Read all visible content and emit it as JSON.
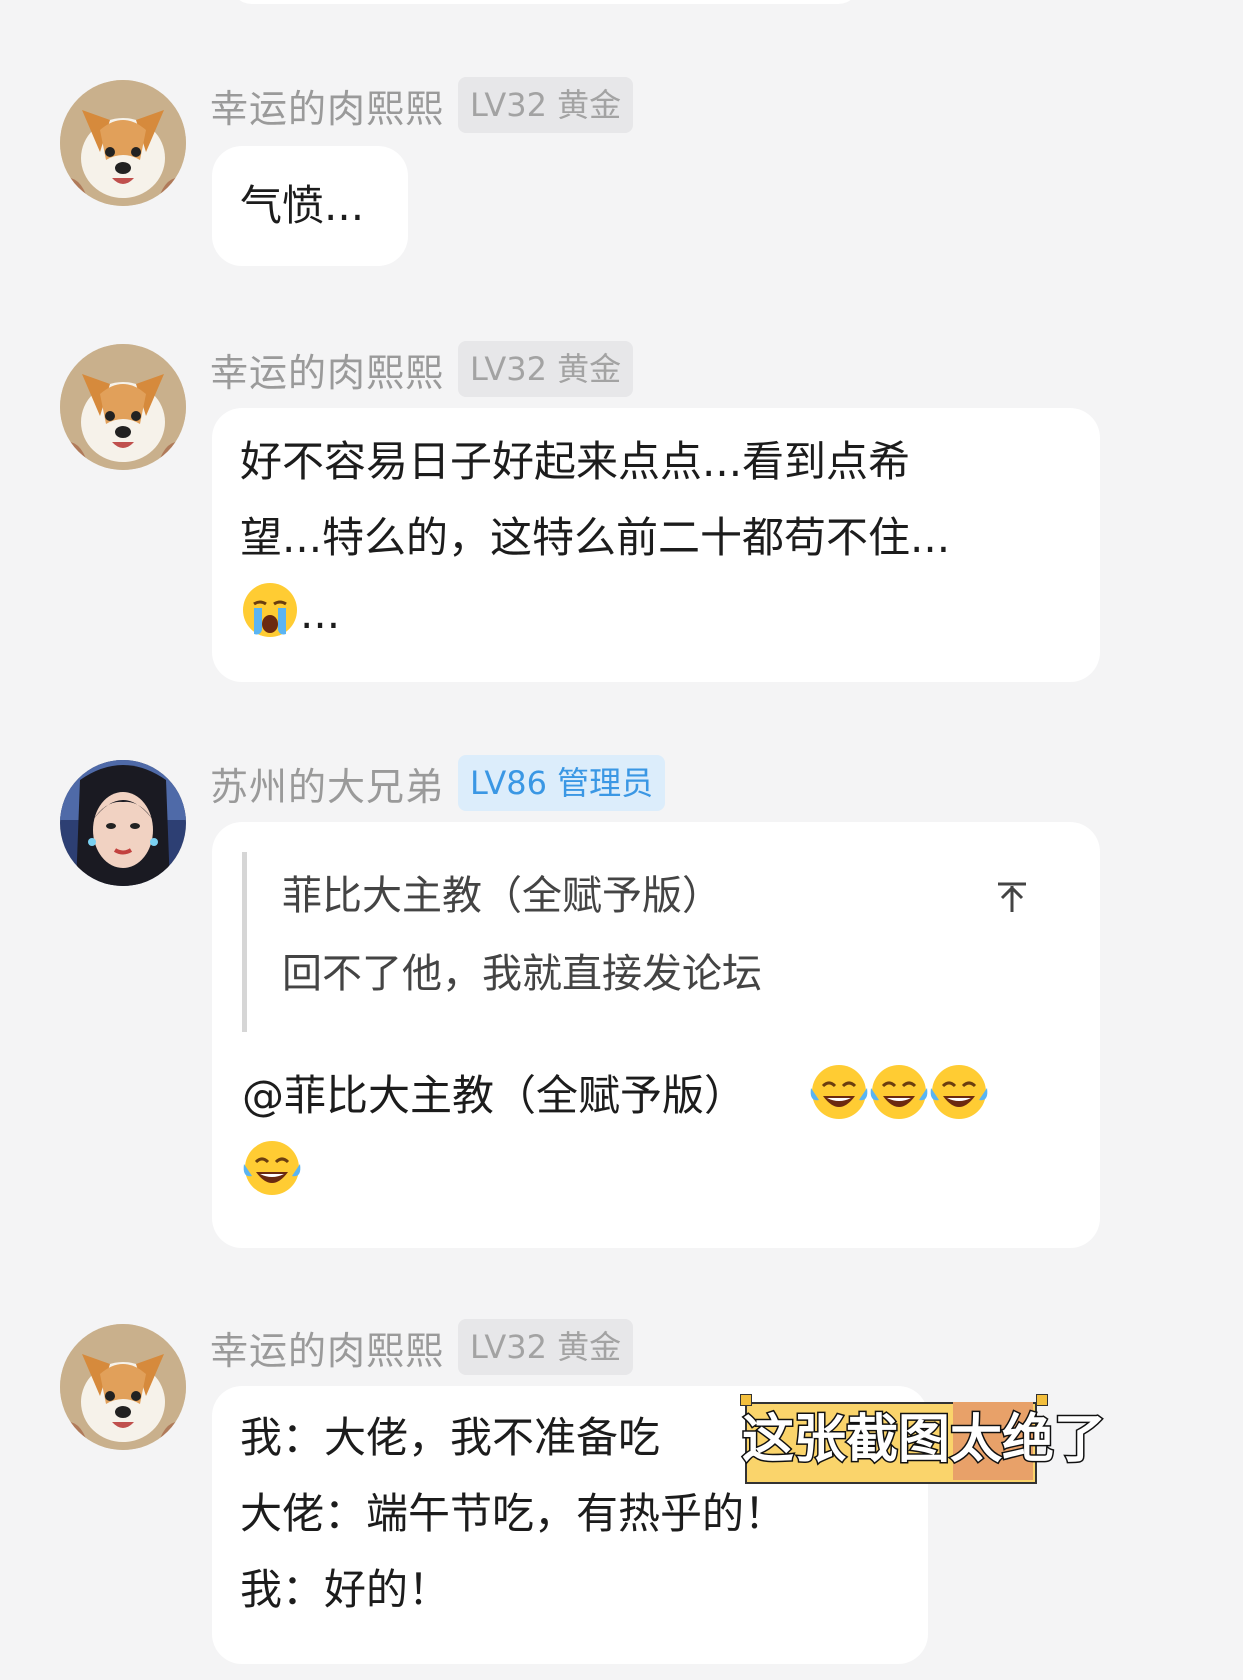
{
  "messages": [
    {
      "username": "幸运的肉熙熙",
      "badge": "LV32 黄金",
      "avatar": "corgi-avatar",
      "lines": [
        "气愤..."
      ]
    },
    {
      "username": "幸运的肉熙熙",
      "badge": "LV32 黄金",
      "avatar": "corgi-avatar",
      "lines": [
        "好不容易日子好起来点点...看到点希",
        "望...特么的，这特么前二十都苟不住...",
        "..."
      ],
      "emoji": "crying-face-emoji"
    },
    {
      "username": "苏州的大兄弟",
      "badge": "LV86 管理员",
      "avatar": "woman-portrait-avatar",
      "quote": {
        "name": "菲比大主教（全赋予版）",
        "text": "回不了他，我就直接发论坛",
        "icon": "arrow-up-icon"
      },
      "lines": [
        "@菲比大主教（全赋予版）"
      ],
      "emoji": "tears-of-joy-emoji"
    },
    {
      "username": "幸运的肉熙熙",
      "badge": "LV32 黄金",
      "avatar": "corgi-avatar",
      "lines": [
        "我：大佬，我不准备吃",
        "大佬：端午节吃，有热乎的！",
        "我：好的！"
      ]
    }
  ],
  "caption": "这张截图太绝了",
  "colors": {
    "background": "#f4f4f5",
    "bubble": "#ffffff",
    "username": "#9a9a9a",
    "badge_gold_text": "#a3a3a3",
    "badge_admin_text": "#3a97e4",
    "caption_highlight": "#fad46b"
  }
}
